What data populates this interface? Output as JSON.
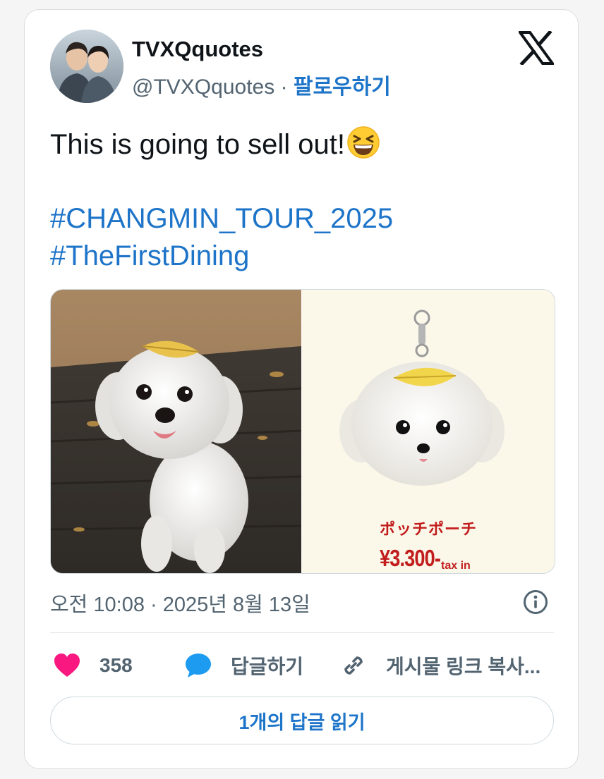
{
  "author": {
    "display_name": "TVXQquotes",
    "handle": "@TVXQquotes",
    "separator": "·",
    "follow_label": "팔로우하기"
  },
  "tweet": {
    "text": "This is going to sell out!",
    "emoji": "grinning-squinting-face",
    "hashtags": [
      "#CHANGMIN_TOUR_2025",
      "#TheFirstDining"
    ],
    "timestamp": "오전 10:08 · 2025년 8월 13일"
  },
  "media": {
    "product_name": "ポッチポーチ",
    "price": "¥3.300-",
    "tax_note": "tax in"
  },
  "actions": {
    "like_count": "358",
    "reply_label": "답글하기",
    "copy_link_label": "게시물 링크 복사..."
  },
  "read_replies_label": "1개의 답글 읽기",
  "colors": {
    "link_blue": "#1d74c8",
    "like_pink": "#f91880",
    "reply_blue": "#1d9bf0",
    "muted_text": "#536471",
    "price_red": "#c21d1d"
  },
  "icons": {
    "platform_logo": "x-logo-icon",
    "info": "info-icon",
    "like": "heart-icon",
    "reply": "speech-bubble-icon",
    "link": "link-icon"
  }
}
